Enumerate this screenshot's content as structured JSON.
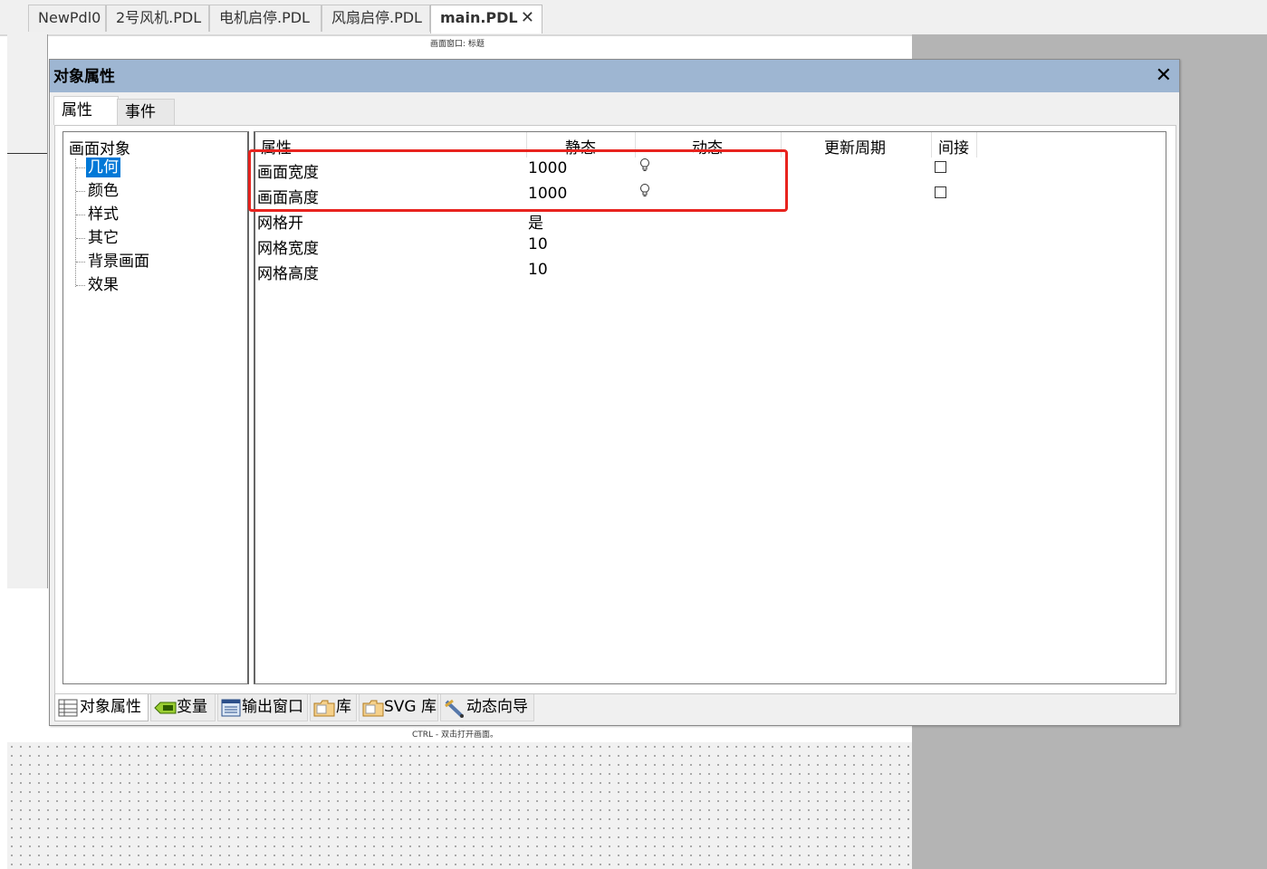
{
  "tabs": [
    {
      "label": "NewPdl0"
    },
    {
      "label": "2号风机.PDL"
    },
    {
      "label": "电机启停.PDL"
    },
    {
      "label": "风扇启停.PDL"
    },
    {
      "label": "main.PDL",
      "active": true,
      "close": "✕"
    }
  ],
  "canvas": {
    "top_hint": "画面窗口: 标题",
    "bottom_hint": "CTRL - 双击打开画面。"
  },
  "dialog": {
    "title": "对象属性",
    "close": "✕",
    "tabs": [
      "属性",
      "事件"
    ],
    "tree": {
      "root": "画面对象",
      "items": [
        "几何",
        "颜色",
        "样式",
        "其它",
        "背景画面",
        "效果"
      ],
      "selected": "几何"
    },
    "columns": [
      "属性",
      "静态",
      "动态",
      "更新周期",
      "间接"
    ],
    "rows": [
      {
        "property": "画面宽度",
        "static": "1000",
        "dynamic_icon": "lightbulb-icon",
        "indirect": "unchecked"
      },
      {
        "property": "画面高度",
        "static": "1000",
        "dynamic_icon": "lightbulb-icon",
        "indirect": "unchecked"
      },
      {
        "property": "网格开",
        "static": "是"
      },
      {
        "property": "网格宽度",
        "static": "10"
      },
      {
        "property": "网格高度",
        "static": "10"
      }
    ],
    "bottom_tabs": [
      {
        "label": "对象属性",
        "icon": "properties-icon"
      },
      {
        "label": "变量",
        "icon": "tag-icon"
      },
      {
        "label": "输出窗口",
        "icon": "output-window-icon"
      },
      {
        "label": "库",
        "icon": "folder-icon"
      },
      {
        "label": "SVG 库",
        "icon": "folder-icon"
      },
      {
        "label": "动态向导",
        "icon": "wizard-icon"
      }
    ]
  },
  "colors": {
    "title_bar": "#9eb6d2",
    "selection": "#0078d7",
    "highlight_box": "#e8231e"
  }
}
